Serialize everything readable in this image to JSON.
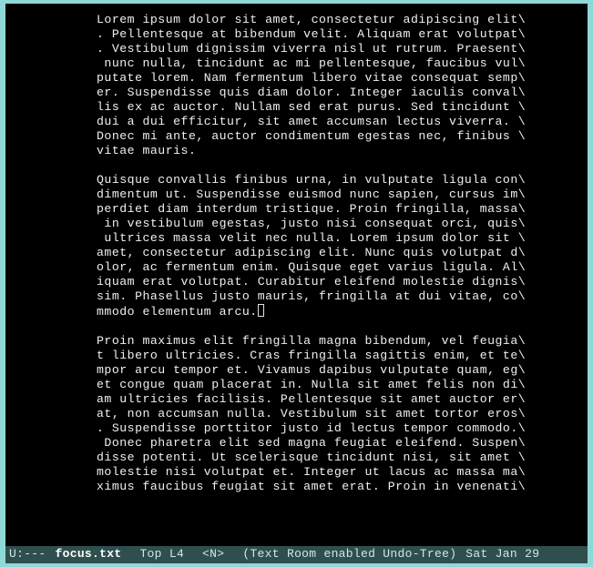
{
  "paragraphs": [
    [
      "Lorem ipsum dolor sit amet, consectetur adipiscing elit\\",
      ". Pellentesque at bibendum velit. Aliquam erat volutpat\\",
      ". Vestibulum dignissim viverra nisl ut rutrum. Praesent\\",
      " nunc nulla, tincidunt ac mi pellentesque, faucibus vul\\",
      "putate lorem. Nam fermentum libero vitae consequat semp\\",
      "er. Suspendisse quis diam dolor. Integer iaculis conval\\",
      "lis ex ac auctor. Nullam sed erat purus. Sed tincidunt \\",
      "dui a dui efficitur, sit amet accumsan lectus viverra. \\",
      "Donec mi ante, auctor condimentum egestas nec, finibus \\",
      "vitae mauris."
    ],
    [
      "Quisque convallis finibus urna, in vulputate ligula con\\",
      "dimentum ut. Suspendisse euismod nunc sapien, cursus im\\",
      "perdiet diam interdum tristique. Proin fringilla, massa\\",
      " in vestibulum egestas, justo nisi consequat orci, quis\\",
      " ultrices massa velit nec nulla. Lorem ipsum dolor sit \\",
      "amet, consectetur adipiscing elit. Nunc quis volutpat d\\",
      "olor, ac fermentum enim. Quisque eget varius ligula. Al\\",
      "iquam erat volutpat. Curabitur eleifend molestie dignis\\",
      "sim. Phasellus justo mauris, fringilla at dui vitae, co\\",
      "mmodo elementum arcu."
    ],
    [
      "Proin maximus elit fringilla magna bibendum, vel feugia\\",
      "t libero ultricies. Cras fringilla sagittis enim, et te\\",
      "mpor arcu tempor et. Vivamus dapibus vulputate quam, eg\\",
      "et congue quam placerat in. Nulla sit amet felis non di\\",
      "am ultricies facilisis. Pellentesque sit amet auctor er\\",
      "at, non accumsan nulla. Vestibulum sit amet tortor eros\\",
      ". Suspendisse porttitor justo id lectus tempor commodo.\\",
      " Donec pharetra elit sed magna feugiat eleifend. Suspen\\",
      "disse potenti. Ut scelerisque tincidunt nisi, sit amet \\",
      "molestie nisi volutpat et. Integer ut lacus ac massa ma\\",
      "ximus faucibus feugiat sit amet erat. Proin in venenati\\"
    ]
  ],
  "cursor": {
    "paragraph": 1,
    "line": 9,
    "after_text": true
  },
  "modeline": {
    "left": "U:---",
    "filename": "focus.txt",
    "position": "Top L4",
    "mode_bracket": "<N>",
    "minor": "(Text Room enabled Undo-Tree)",
    "date": "Sat Jan 29"
  }
}
